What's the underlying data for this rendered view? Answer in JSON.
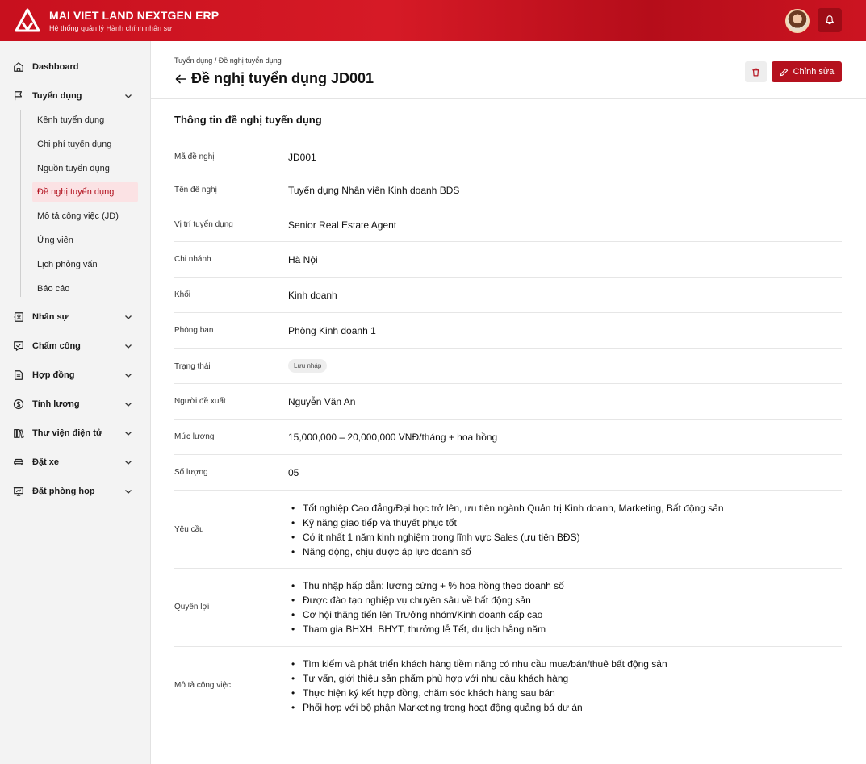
{
  "header": {
    "title": "MAI VIET LAND NEXTGEN ERP",
    "subtitle": "Hệ thống quản lý Hành chính nhân sự",
    "accent": "#c8101e"
  },
  "sidebar": {
    "items": [
      {
        "label": "Dashboard",
        "icon": "home-icon"
      },
      {
        "label": "Tuyển dụng",
        "icon": "flag-icon"
      },
      {
        "label": "Nhân sự",
        "icon": "contact-icon"
      },
      {
        "label": "Chấm công",
        "icon": "timesheet-icon"
      },
      {
        "label": "Hợp đồng",
        "icon": "document-icon"
      },
      {
        "label": "Tính lương",
        "icon": "dollar-icon"
      },
      {
        "label": "Thư viện điện tử",
        "icon": "library-icon"
      },
      {
        "label": "Đặt xe",
        "icon": "car-icon"
      },
      {
        "label": "Đặt phòng họp",
        "icon": "presentation-icon"
      }
    ],
    "recruitment_sub": [
      "Kênh tuyển dụng",
      "Chi phí tuyển dụng",
      "Nguồn tuyển dụng",
      "Đề nghị tuyển dụng",
      "Mô tả công việc (JD)",
      "Ứng viên",
      "Lịch phỏng vấn",
      "Báo cáo"
    ],
    "active_sub": "Đề nghị tuyển dụng"
  },
  "page": {
    "breadcrumb": "Tuyển dụng / Đề nghị tuyển dụng",
    "title": "Đề nghị tuyển dụng JD001",
    "edit_label": "Chỉnh sửa",
    "section_title": "Thông tin đề nghị tuyển dụng"
  },
  "details": {
    "ma_de_nghi": {
      "label": "Mã đề nghị",
      "value": "JD001"
    },
    "ten_de_nghi": {
      "label": "Tên đề nghị",
      "value": "Tuyển dụng Nhân viên Kinh doanh BĐS"
    },
    "vi_tri": {
      "label": "Vị trí tuyển dụng",
      "value": "Senior Real Estate Agent"
    },
    "chi_nhanh": {
      "label": "Chi nhánh",
      "value": "Hà Nội"
    },
    "khoi": {
      "label": "Khối",
      "value": "Kinh doanh"
    },
    "phong_ban": {
      "label": "Phòng ban",
      "value": "Phòng Kinh doanh 1"
    },
    "trang_thai": {
      "label": "Trạng thái",
      "value": "Lưu nháp"
    },
    "nguoi_de_xuat": {
      "label": "Người đề xuất",
      "value": "Nguyễn Văn An"
    },
    "muc_luong": {
      "label": "Mức lương",
      "value": "15,000,000 – 20,000,000 VNĐ/tháng + hoa hồng"
    },
    "so_luong": {
      "label": "Số lượng",
      "value": "05"
    },
    "yeu_cau": {
      "label": "Yêu cầu",
      "items": [
        "Tốt nghiệp Cao đẳng/Đại học trở lên, ưu tiên ngành Quản trị Kinh doanh, Marketing, Bất động sản",
        "Kỹ năng giao tiếp và thuyết phục tốt",
        "Có ít nhất 1 năm kinh nghiệm trong lĩnh vực Sales (ưu tiên BĐS)",
        "Năng động, chịu được áp lực doanh số"
      ]
    },
    "quyen_loi": {
      "label": "Quyền lợi",
      "items": [
        "Thu nhập hấp dẫn: lương cứng + % hoa hồng theo doanh số",
        "Được đào tạo nghiệp vụ chuyên sâu về bất động sản",
        "Cơ hội thăng tiến lên Trưởng nhóm/Kinh doanh cấp cao",
        "Tham gia BHXH, BHYT, thưởng lễ Tết, du lịch hằng năm"
      ]
    },
    "mo_ta": {
      "label": "Mô tả công việc",
      "items": [
        "Tìm kiếm và phát triển khách hàng tiềm năng có nhu cầu mua/bán/thuê bất động sản",
        "Tư vấn, giới thiệu sản phẩm phù hợp với nhu cầu khách hàng",
        "Thực hiện ký kết hợp đồng, chăm sóc khách hàng sau bán",
        "Phối hợp với bộ phận Marketing trong hoạt động quảng bá dự án"
      ]
    }
  }
}
